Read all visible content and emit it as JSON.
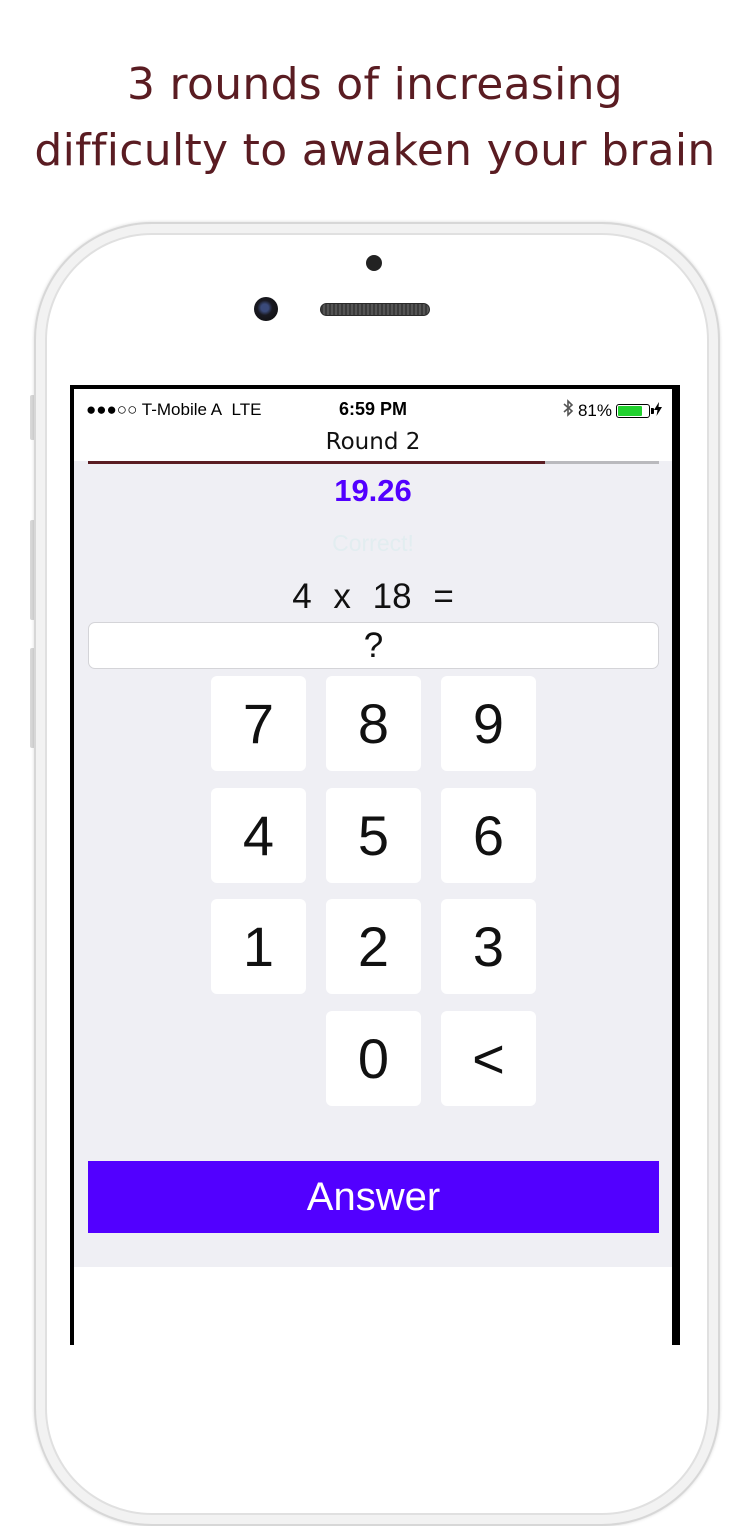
{
  "headline": {
    "line1": "3 rounds of increasing",
    "line2": "difficulty to awaken your brain"
  },
  "status_bar": {
    "signal": "●●●○○",
    "carrier": "T-Mobile A",
    "network": "LTE",
    "time": "6:59 PM",
    "battery_percent": "81%",
    "battery_level": 0.81,
    "icons": [
      "bluetooth-icon",
      "battery-icon",
      "charging-bolt-icon"
    ]
  },
  "nav": {
    "title": "Round 2"
  },
  "round_progress": 0.8,
  "timer": "19.26",
  "feedback": "Correct!",
  "question": {
    "a": "4",
    "op": "x",
    "b": "18",
    "eq": "="
  },
  "answer_field": {
    "value": "?"
  },
  "keypad": {
    "k7": "7",
    "k8": "8",
    "k9": "9",
    "k4": "4",
    "k5": "5",
    "k6": "6",
    "k1": "1",
    "k2": "2",
    "k3": "3",
    "k0": "0",
    "backspace": "<"
  },
  "answer_button": {
    "label": "Answer"
  },
  "colors": {
    "headline": "#5a1c22",
    "accent": "#5200ff",
    "progress": "#5a1c22",
    "battery": "#22d12f"
  }
}
